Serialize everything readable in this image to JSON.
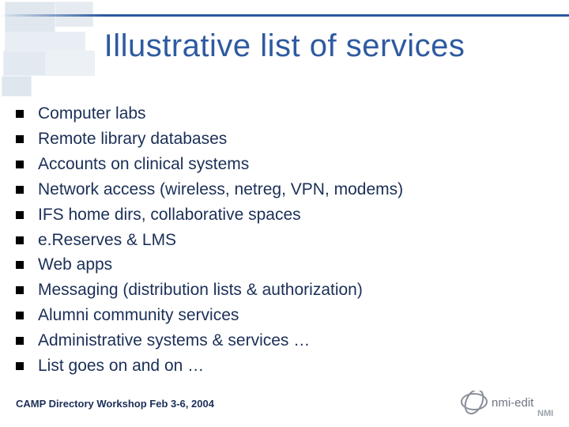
{
  "title": "Illustrative list of services",
  "items": [
    "Computer labs",
    "Remote library databases",
    "Accounts on clinical systems",
    "Network access (wireless, netreg, VPN, modems)",
    "IFS home dirs, collaborative spaces",
    "e.Reserves & LMS",
    "Web apps",
    "Messaging (distribution lists & authorization)",
    "Alumni community services",
    "Administrative systems & services …",
    "List goes on and on …"
  ],
  "footer": "CAMP Directory Workshop  Feb 3-6, 2004",
  "logo": {
    "text": "nmi-edit",
    "sub": "NMI"
  }
}
